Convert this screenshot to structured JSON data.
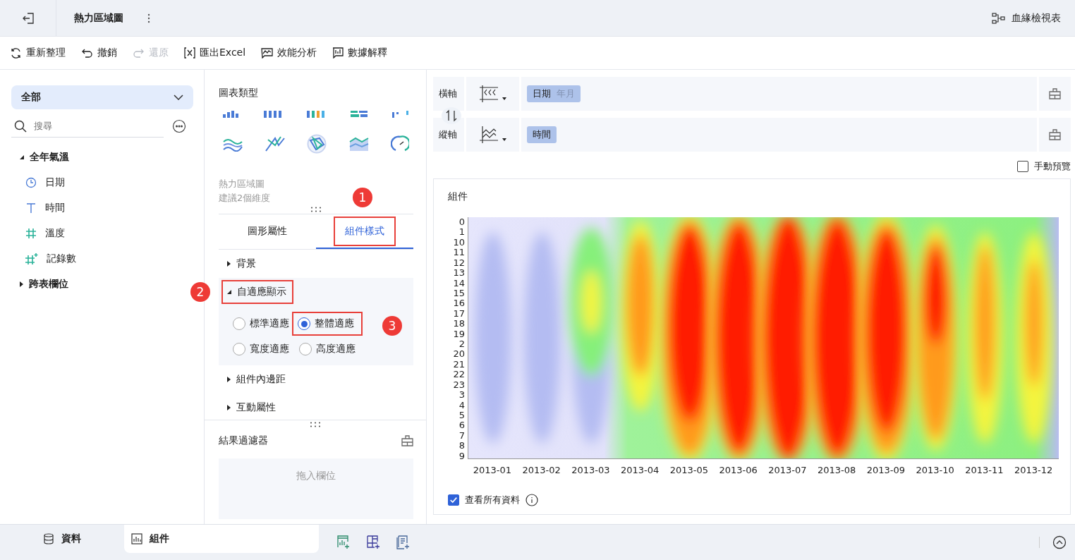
{
  "app_bar": {
    "title": "熱力區域圖",
    "lineage_label": "血緣檢視表"
  },
  "toolbar": [
    {
      "label": "重新整理",
      "disabled": false
    },
    {
      "label": "撤銷",
      "disabled": false
    },
    {
      "label": "還原",
      "disabled": true
    },
    {
      "label": "匯出Excel",
      "disabled": false
    },
    {
      "label": "效能分析",
      "disabled": false
    },
    {
      "label": "數據解釋",
      "disabled": false
    }
  ],
  "data_panel": {
    "dataset_select": "全部",
    "search": {
      "placeholder": "搜尋"
    },
    "tree": [
      {
        "label": "全年氣溫",
        "expanded": true,
        "children": [
          {
            "label": "日期",
            "kind": "date"
          },
          {
            "label": "時間",
            "kind": "text"
          },
          {
            "label": "溫度",
            "kind": "number"
          },
          {
            "label": "記錄數",
            "kind": "calc"
          }
        ]
      },
      {
        "label": "跨表欄位",
        "expanded": false
      }
    ]
  },
  "chart_panel": {
    "title": "圖表類型",
    "chart_name": "熱力區域圖",
    "hint": "建議2個維度",
    "tabs": [
      {
        "label": "圖形屬性",
        "selected": false
      },
      {
        "label": "組件樣式",
        "selected": true,
        "callout": "1"
      }
    ],
    "sections": [
      {
        "label": "背景",
        "expanded": false
      },
      {
        "label": "自適應顯示",
        "expanded": true,
        "callout": "2",
        "options": [
          {
            "label": "標準適應",
            "selected": false
          },
          {
            "label": "整體適應",
            "selected": true,
            "callout": "3"
          },
          {
            "label": "寬度適應",
            "selected": false
          },
          {
            "label": "高度適應",
            "selected": false
          }
        ]
      },
      {
        "label": "組件內邊距",
        "expanded": false
      },
      {
        "label": "互動屬性",
        "expanded": false
      }
    ],
    "filter": {
      "title": "結果過濾器",
      "drop_hint": "拖入欄位"
    }
  },
  "axes": [
    {
      "label": "橫軸",
      "pills": [
        {
          "text": "日期",
          "sub": "年月"
        }
      ]
    },
    {
      "label": "縱軸",
      "pills": [
        {
          "text": "時間"
        }
      ]
    }
  ],
  "manual_preview": {
    "label": "手動預覽",
    "checked": false
  },
  "widget": {
    "title": "組件",
    "heatmap": {
      "x_labels": [
        "2013-01",
        "2013-02",
        "2013-03",
        "2013-04",
        "2013-05",
        "2013-06",
        "2013-07",
        "2013-08",
        "2013-09",
        "2013-10",
        "2013-11",
        "2013-12"
      ],
      "y_labels": [
        "0",
        "1",
        "10",
        "11",
        "12",
        "13",
        "14",
        "15",
        "16",
        "17",
        "18",
        "19",
        "2",
        "20",
        "21",
        "22",
        "23",
        "3",
        "4",
        "5",
        "6",
        "7",
        "8",
        "9"
      ]
    },
    "view_all": {
      "label": "查看所有資料",
      "checked": true
    }
  },
  "bottom_tabs": [
    {
      "label": "資料",
      "selected": false
    },
    {
      "label": "組件",
      "selected": true
    }
  ]
}
